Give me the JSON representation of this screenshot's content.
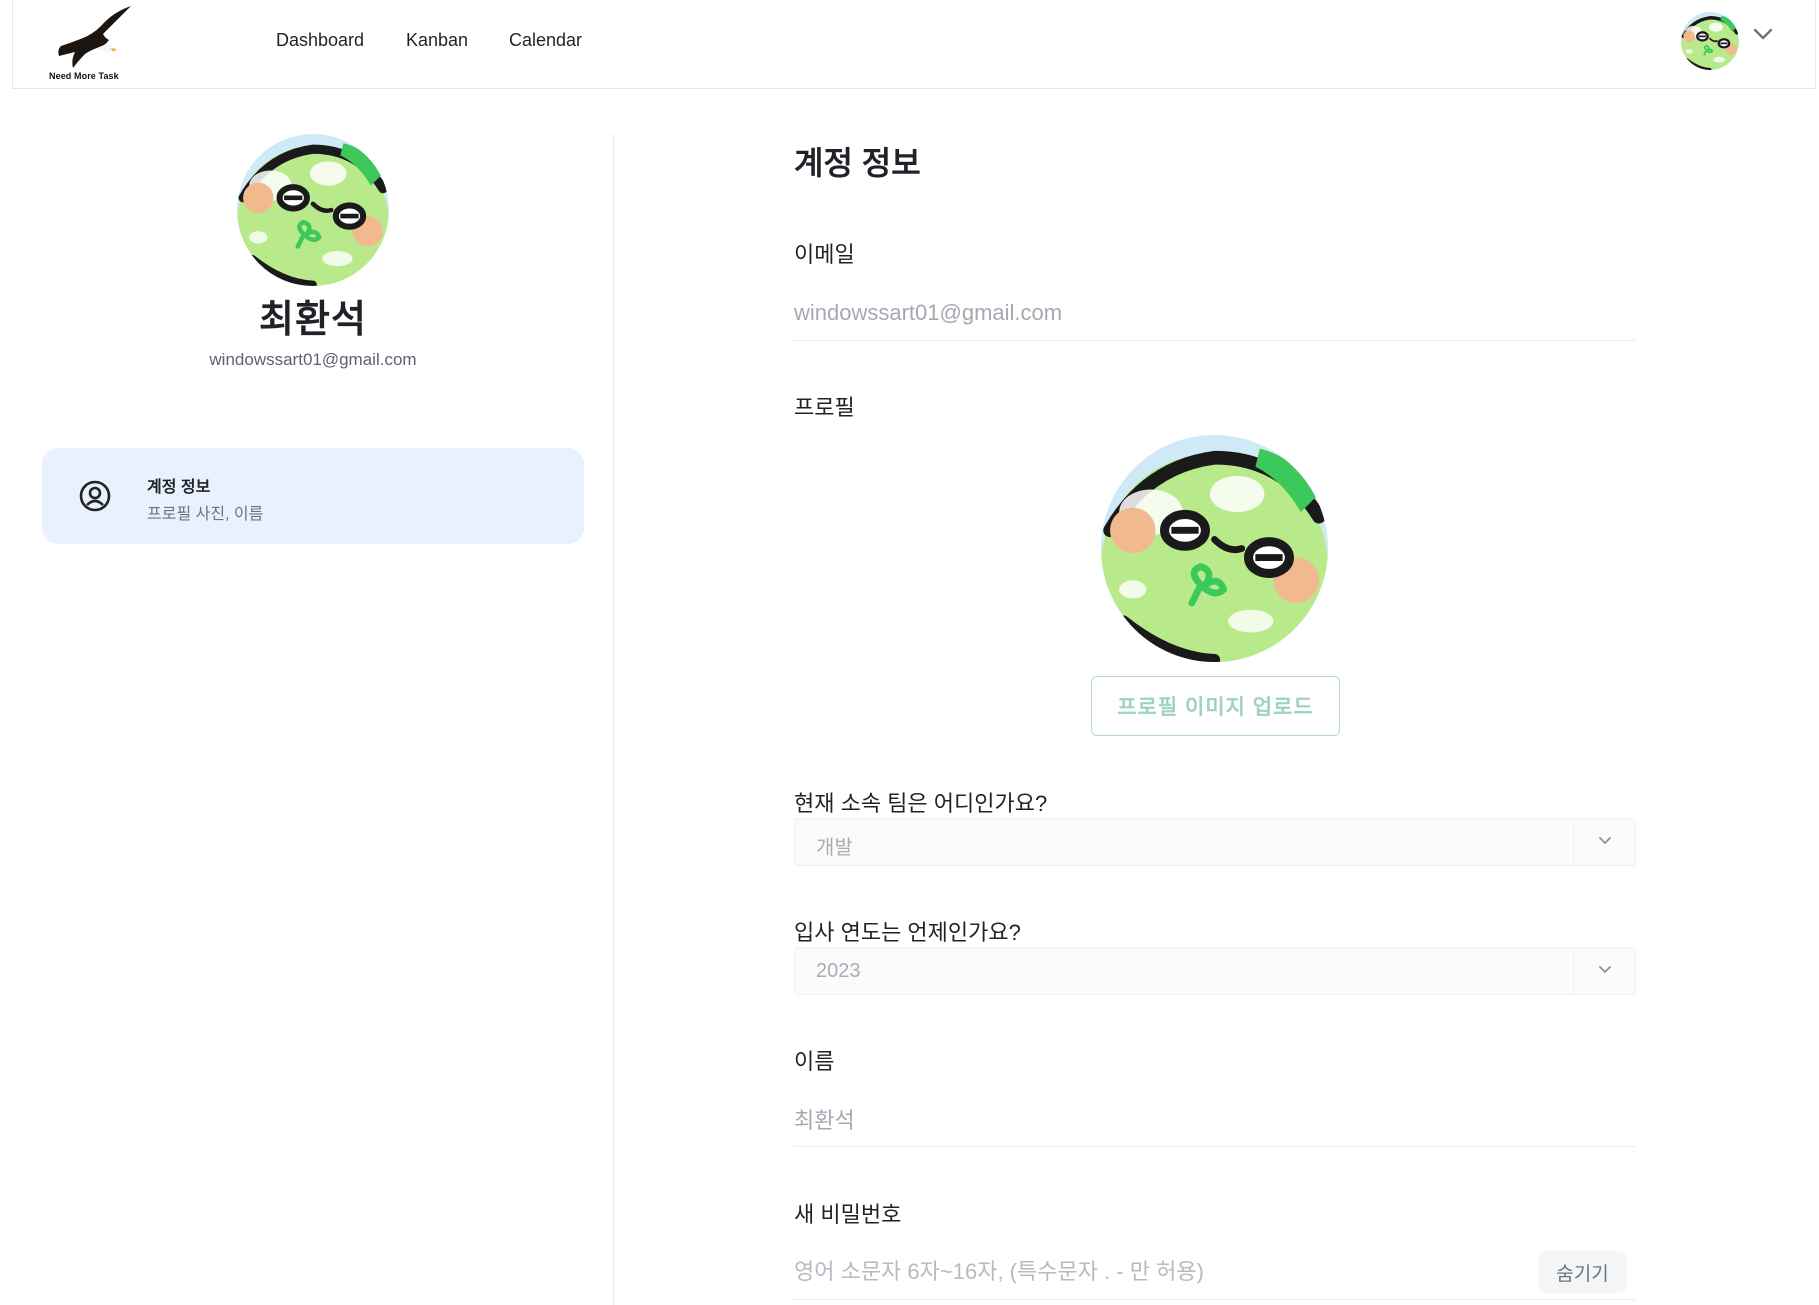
{
  "header": {
    "logo_text": "Need More Task",
    "nav": [
      "Dashboard",
      "Kanban",
      "Calendar"
    ]
  },
  "sidebar": {
    "user_name": "최환석",
    "user_email": "windowssart01@gmail.com",
    "menu": [
      {
        "title": "계정 정보",
        "subtitle": "프로필 사진, 이름",
        "icon": "user-circle-icon",
        "active": true
      }
    ]
  },
  "account": {
    "title": "계정 정보",
    "email_label": "이메일",
    "email_value": "windowssart01@gmail.com",
    "profile_label": "프로필",
    "upload_button": "프로필 이미지 업로드",
    "team_label": "현재 소속 팀은 어디인가요?",
    "team_value": "개발",
    "year_label": "입사 연도는 언제인가요?",
    "year_value": "2023",
    "name_label": "이름",
    "name_value": "최환석",
    "password_label": "새 비밀번호",
    "password_placeholder": "영어 소문자 6자~16자, (특수문자 . - 만 허용)",
    "password_toggle": "숨기기"
  },
  "colors": {
    "active_menu_bg": "#eaf1fe",
    "upload_border": "#b4dccc",
    "upload_text": "#9ed3bd",
    "avatar_green": "#b5e88a"
  }
}
